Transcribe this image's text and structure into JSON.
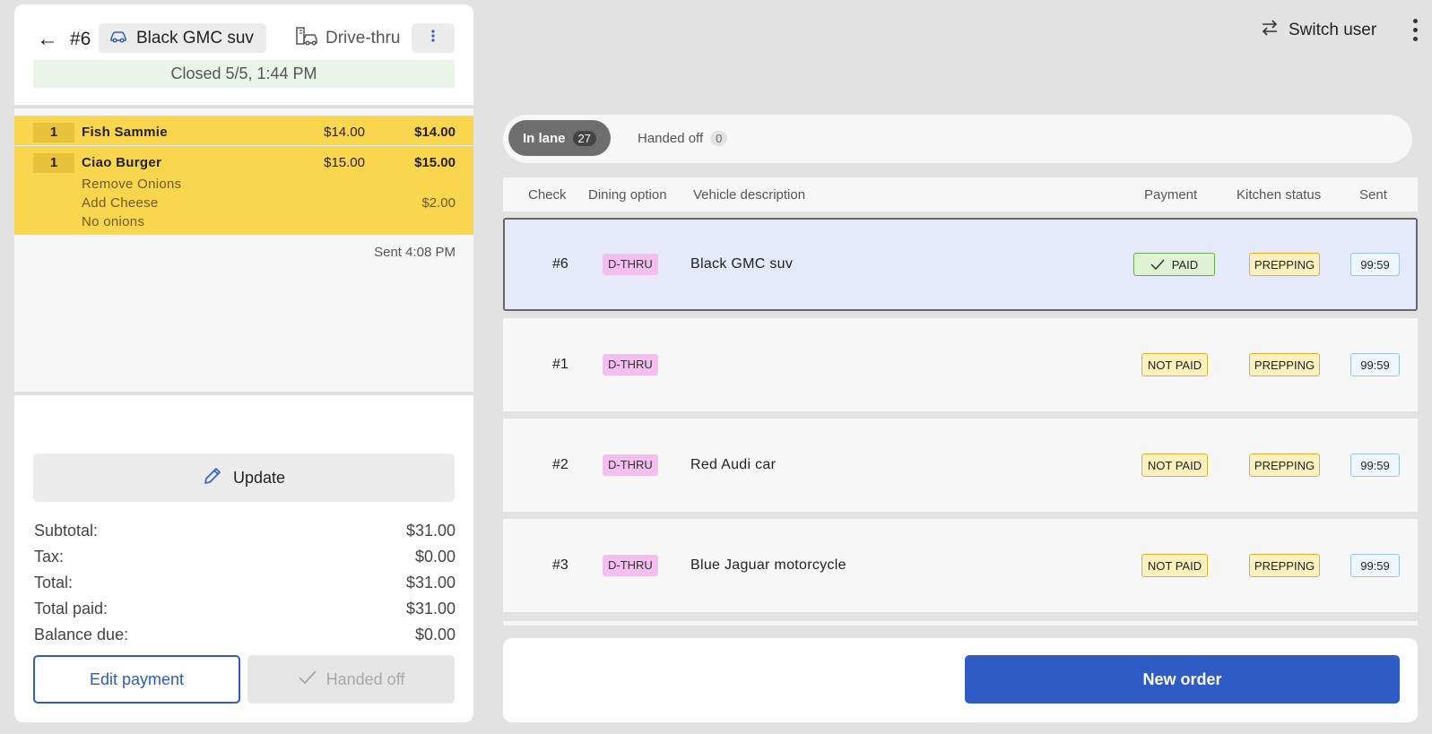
{
  "order": {
    "back_icon": "arrow-left-icon",
    "check_number": "#6",
    "vehicle": "Black GMC suv",
    "vehicle_icon": "car-icon",
    "dining_option": "Drive-thru",
    "dining_icon": "drive-thru-icon",
    "closed_status": "Closed 5/5, 1:44 PM",
    "items": [
      {
        "qty": "1",
        "name": "Fish Sammie",
        "price": "$14.00",
        "total": "$14.00",
        "modifiers": []
      },
      {
        "qty": "1",
        "name": "Ciao Burger",
        "price": "$15.00",
        "total": "$15.00",
        "modifiers": [
          {
            "label": "Remove Onions",
            "price": ""
          },
          {
            "label": "Add Cheese",
            "price": "$2.00"
          },
          {
            "label": "No onions",
            "price": ""
          }
        ]
      }
    ],
    "sent_time": "Sent 4:08 PM",
    "update_label": "Update",
    "totals": [
      {
        "label": "Subtotal:",
        "value": "$31.00"
      },
      {
        "label": "Tax:",
        "value": "$0.00"
      },
      {
        "label": "Total:",
        "value": "$31.00"
      },
      {
        "label": "Total paid:",
        "value": "$31.00"
      },
      {
        "label": "Balance due:",
        "value": "$0.00"
      }
    ],
    "edit_payment_label": "Edit payment",
    "handed_off_label": "Handed off"
  },
  "topbar": {
    "switch_user_label": "Switch user"
  },
  "tabs": [
    {
      "label": "In lane",
      "count": "27",
      "active": true
    },
    {
      "label": "Handed off",
      "count": "0",
      "active": false
    }
  ],
  "table": {
    "headers": [
      "Check",
      "Dining option",
      "Vehicle description",
      "Payment",
      "Kitchen status",
      "Sent"
    ],
    "rows": [
      {
        "check": "#6",
        "dining": "D-THRU",
        "vehicle": "Black GMC suv",
        "payment": "PAID",
        "kitchen": "PREPPING",
        "sent": "99:59",
        "selected": true
      },
      {
        "check": "#1",
        "dining": "D-THRU",
        "vehicle": "",
        "payment": "NOT PAID",
        "kitchen": "PREPPING",
        "sent": "99:59",
        "selected": false
      },
      {
        "check": "#2",
        "dining": "D-THRU",
        "vehicle": "Red Audi car",
        "payment": "NOT PAID",
        "kitchen": "PREPPING",
        "sent": "99:59",
        "selected": false
      },
      {
        "check": "#3",
        "dining": "D-THRU",
        "vehicle": "Blue Jaguar motorcycle",
        "payment": "NOT PAID",
        "kitchen": "PREPPING",
        "sent": "99:59",
        "selected": false
      }
    ]
  },
  "new_order_label": "New order",
  "colors": {
    "accent": "#2e5bc4",
    "item_highlight": "#fad54e",
    "selected_row": "#e5e9f9",
    "dining_badge": "#f3bff0"
  }
}
